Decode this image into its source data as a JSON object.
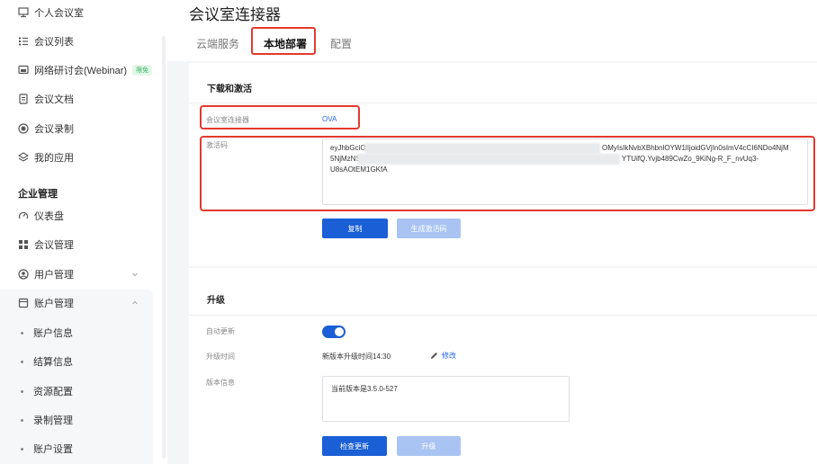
{
  "sidebar": {
    "items": [
      {
        "label": "个人会议室",
        "icon": "meeting-room-icon"
      },
      {
        "label": "会议列表",
        "icon": "list-icon"
      },
      {
        "label": "网络研讨会(Webinar)",
        "icon": "webinar-icon",
        "badge": "限免"
      },
      {
        "label": "会议文档",
        "icon": "document-icon"
      },
      {
        "label": "会议录制",
        "icon": "record-icon"
      },
      {
        "label": "我的应用",
        "icon": "apps-icon"
      }
    ],
    "section_title": "企业管理",
    "admin_items": [
      {
        "label": "仪表盘",
        "icon": "dashboard-icon"
      },
      {
        "label": "会议管理",
        "icon": "grid-icon"
      },
      {
        "label": "用户管理",
        "icon": "user-icon"
      },
      {
        "label": "账户管理",
        "icon": "account-icon"
      }
    ],
    "account_sub_items": [
      "账户信息",
      "结算信息",
      "资源配置",
      "录制管理",
      "账户设置"
    ]
  },
  "header": {
    "title": "会议室连接器",
    "tabs": [
      "云端服务",
      "本地部署",
      "配置"
    ],
    "active_tab": "本地部署"
  },
  "download_card": {
    "title": "下载和激活",
    "connector_label": "会议室连接器",
    "connector_value": "OVA",
    "activation_label": "激活码",
    "code_lines": [
      "eyJhbGciO",
      "5NjMzNSw",
      "U8sAOtEM1GKfA"
    ],
    "code_line_right_1": "OMyIsIkNvbXBhbnlOYW1lIjoidGVjIn0sImV4cCI6NDo4NjM",
    "code_line_right_2": "YTUifQ.Yvjb489CwZo_9KiNg-R_F_nvUq3-",
    "copy_button": "复制",
    "generate_button": "生成激活码"
  },
  "upgrade_card": {
    "title": "升级",
    "auto_update_label": "自动更新",
    "auto_update_on": true,
    "upgrade_time_label": "升级时间",
    "upgrade_time_value": "新版本升级时间14:30",
    "edit_label": "修改",
    "version_label": "版本信息",
    "version_value": "当前版本是3.5.0-527",
    "check_button": "检查更新",
    "upgrade_button": "升级"
  },
  "colors": {
    "accent": "#1a5fd6",
    "accent_disabled": "#a9c4f2",
    "annotation_red": "#e23a2e",
    "link": "#2566e6"
  }
}
